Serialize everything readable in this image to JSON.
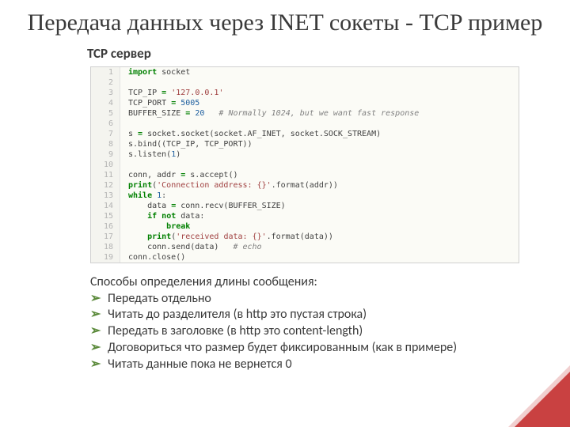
{
  "title": "Передача данных через INET сокеты - TCP пример",
  "subtitle": "TCP сервер",
  "code": {
    "lines": [
      {
        "n": 1,
        "tokens": [
          [
            "kw",
            "import"
          ],
          [
            "nm",
            " socket"
          ]
        ]
      },
      {
        "n": 2,
        "tokens": []
      },
      {
        "n": 3,
        "tokens": [
          [
            "nm",
            "TCP_IP "
          ],
          [
            "kw",
            "="
          ],
          [
            "nm",
            " "
          ],
          [
            "str",
            "'127.0.0.1'"
          ]
        ]
      },
      {
        "n": 4,
        "tokens": [
          [
            "nm",
            "TCP_PORT "
          ],
          [
            "kw",
            "="
          ],
          [
            "nm",
            " "
          ],
          [
            "num",
            "5005"
          ]
        ]
      },
      {
        "n": 5,
        "tokens": [
          [
            "nm",
            "BUFFER_SIZE "
          ],
          [
            "kw",
            "="
          ],
          [
            "nm",
            " "
          ],
          [
            "num",
            "20"
          ],
          [
            "nm",
            "   "
          ],
          [
            "cm",
            "# Normally 1024, but we want fast response"
          ]
        ]
      },
      {
        "n": 6,
        "tokens": []
      },
      {
        "n": 7,
        "tokens": [
          [
            "nm",
            "s "
          ],
          [
            "kw",
            "="
          ],
          [
            "nm",
            " socket.socket(socket.AF_INET, socket.SOCK_STREAM)"
          ]
        ]
      },
      {
        "n": 8,
        "tokens": [
          [
            "nm",
            "s.bind((TCP_IP, TCP_PORT))"
          ]
        ]
      },
      {
        "n": 9,
        "tokens": [
          [
            "nm",
            "s.listen("
          ],
          [
            "num",
            "1"
          ],
          [
            "nm",
            ")"
          ]
        ]
      },
      {
        "n": 10,
        "tokens": []
      },
      {
        "n": 11,
        "tokens": [
          [
            "nm",
            "conn, addr "
          ],
          [
            "kw",
            "="
          ],
          [
            "nm",
            " s.accept()"
          ]
        ]
      },
      {
        "n": 12,
        "tokens": [
          [
            "kw",
            "print"
          ],
          [
            "nm",
            "("
          ],
          [
            "str",
            "'Connection address: {}'"
          ],
          [
            "nm",
            ".format(addr))"
          ]
        ]
      },
      {
        "n": 13,
        "tokens": [
          [
            "kw",
            "while"
          ],
          [
            "nm",
            " "
          ],
          [
            "num",
            "1"
          ],
          [
            "nm",
            ":"
          ]
        ]
      },
      {
        "n": 14,
        "tokens": [
          [
            "nm",
            "    data "
          ],
          [
            "kw",
            "="
          ],
          [
            "nm",
            " conn.recv(BUFFER_SIZE)"
          ]
        ]
      },
      {
        "n": 15,
        "tokens": [
          [
            "nm",
            "    "
          ],
          [
            "kw",
            "if"
          ],
          [
            "nm",
            " "
          ],
          [
            "kw",
            "not"
          ],
          [
            "nm",
            " data:"
          ]
        ]
      },
      {
        "n": 16,
        "tokens": [
          [
            "nm",
            "        "
          ],
          [
            "kw",
            "break"
          ]
        ]
      },
      {
        "n": 17,
        "tokens": [
          [
            "nm",
            "    "
          ],
          [
            "kw",
            "print"
          ],
          [
            "nm",
            "("
          ],
          [
            "str",
            "'received data: {}'"
          ],
          [
            "nm",
            ".format(data))"
          ]
        ]
      },
      {
        "n": 18,
        "tokens": [
          [
            "nm",
            "    conn.send(data)   "
          ],
          [
            "cm",
            "# echo"
          ]
        ]
      },
      {
        "n": 19,
        "tokens": [
          [
            "nm",
            "conn.close()"
          ]
        ]
      }
    ]
  },
  "methods_intro": "Способы определения длины сообщения:",
  "bullets": [
    "Передать отдельно",
    "Читать до разделителя (в http это пустая строка)",
    "Передать в заголовке (в http это content-length)",
    "Договориться что размер будет фиксированным (как в примере)",
    "Читать данные пока не вернется 0"
  ],
  "bullet_glyph": "➢"
}
